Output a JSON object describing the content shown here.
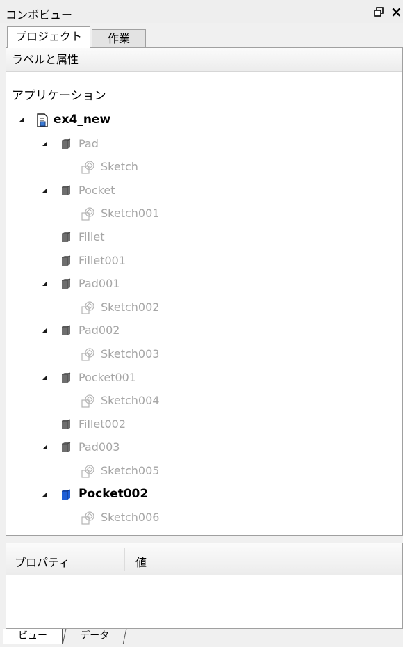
{
  "window": {
    "title": "コンボビュー",
    "float_icon": "float-window-icon",
    "close_label": "×"
  },
  "tabs": [
    {
      "label": "プロジェクト",
      "active": true
    },
    {
      "label": "作業",
      "active": false
    }
  ],
  "tree": {
    "header": "ラベルと属性",
    "root": "アプリケーション",
    "items": [
      {
        "label": "ex4_new",
        "icon": "document-icon",
        "level": 0,
        "expanded": true,
        "style": "document"
      },
      {
        "label": "Pad",
        "icon": "solid-body-icon",
        "level": 1,
        "expanded": true,
        "style": "hidden"
      },
      {
        "label": "Sketch",
        "icon": "sketch-icon",
        "level": 2,
        "style": "hidden"
      },
      {
        "label": "Pocket",
        "icon": "solid-body-icon",
        "level": 1,
        "expanded": true,
        "style": "hidden"
      },
      {
        "label": "Sketch001",
        "icon": "sketch-icon",
        "level": 2,
        "style": "hidden"
      },
      {
        "label": "Fillet",
        "icon": "solid-body-icon",
        "level": 1,
        "style": "hidden"
      },
      {
        "label": "Fillet001",
        "icon": "solid-body-icon",
        "level": 1,
        "style": "hidden"
      },
      {
        "label": "Pad001",
        "icon": "solid-body-icon",
        "level": 1,
        "expanded": true,
        "style": "hidden"
      },
      {
        "label": "Sketch002",
        "icon": "sketch-icon",
        "level": 2,
        "style": "hidden"
      },
      {
        "label": "Pad002",
        "icon": "solid-body-icon",
        "level": 1,
        "expanded": true,
        "style": "hidden"
      },
      {
        "label": "Sketch003",
        "icon": "sketch-icon",
        "level": 2,
        "style": "hidden"
      },
      {
        "label": "Pocket001",
        "icon": "solid-body-icon",
        "level": 1,
        "expanded": true,
        "style": "hidden"
      },
      {
        "label": "Sketch004",
        "icon": "sketch-icon",
        "level": 2,
        "style": "hidden"
      },
      {
        "label": "Fillet002",
        "icon": "solid-body-icon",
        "level": 1,
        "style": "hidden"
      },
      {
        "label": "Pad003",
        "icon": "solid-body-icon",
        "level": 1,
        "expanded": true,
        "style": "hidden"
      },
      {
        "label": "Sketch005",
        "icon": "sketch-icon",
        "level": 2,
        "style": "hidden"
      },
      {
        "label": "Pocket002",
        "icon": "solid-body-icon",
        "level": 1,
        "expanded": true,
        "style": "active"
      },
      {
        "label": "Sketch006",
        "icon": "sketch-icon",
        "level": 2,
        "style": "hidden"
      }
    ]
  },
  "properties": {
    "col_property": "プロパティ",
    "col_value": "値"
  },
  "bottom_tabs": [
    {
      "label": "ビュー",
      "active": true
    },
    {
      "label": "データ",
      "active": false
    }
  ],
  "colors": {
    "hidden_text": "#a6a6a6",
    "hidden_body": "#6e6e6e",
    "active_body": "#1f5fd6",
    "sketch": "#b4b4b4"
  }
}
